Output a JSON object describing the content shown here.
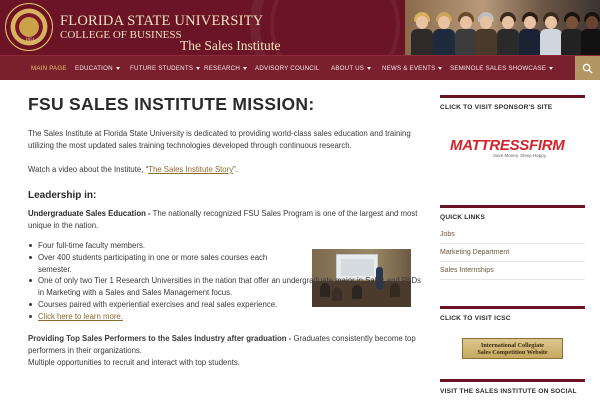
{
  "header": {
    "seal_year": "1851",
    "university": "FLORIDA STATE UNIVERSITY",
    "college": "COLLEGE OF BUSINESS",
    "institute": "The Sales Institute",
    "brand_color": "#6b1425",
    "accent_color": "#b29664"
  },
  "nav": {
    "items": [
      {
        "label": "MAIN PAGE",
        "dropdown": false,
        "active": true
      },
      {
        "label": "EDUCATION",
        "dropdown": true
      },
      {
        "label": "FUTURE STUDENTS",
        "dropdown": true
      },
      {
        "label": "RESEARCH",
        "dropdown": true
      },
      {
        "label": "ADVISORY COUNCIL",
        "dropdown": false
      },
      {
        "label": "ABOUT US",
        "dropdown": true
      },
      {
        "label": "NEWS & EVENTS",
        "dropdown": true
      },
      {
        "label": "SEMINOLE SALES SHOWCASE",
        "dropdown": true
      }
    ],
    "search_icon": "search-icon"
  },
  "main": {
    "title": "FSU SALES INSTITUTE MISSION:",
    "intro": "The Sales Institute at Florida State University is dedicated to  providing world-class sales education and training utilizing the most updated sales training technologies developed through continuous research.",
    "video_prefix": "Watch a video about the Institute, “",
    "video_link": "The Sales Institute Story",
    "video_suffix": "”.",
    "leadership_heading": "Leadership in:",
    "undergrad_heading": "Undergraduate Sales Education -",
    "undergrad_text": " The nationally recognized FSU Sales Program is one of the largest and most unique in the nation.",
    "bullets": [
      "Four full-time faculty members.",
      "Over 400 students participating in one or more sales courses each semester.",
      "One of only two Tier 1 Research Universities in the nation that offer an undergraduate major in Sales and PhDs in Marketing with a Sales and Sales Management focus.",
      "Courses paired with experiential exercises and real sales experience."
    ],
    "learn_more_link": "Click here to learn more.",
    "top_heading": "Providing Top Sales Performers to the Sales Industry after graduation -",
    "top_text": " Graduates consistently become top performers in their organizations.",
    "top_text2": "Multiple opportunities to recruit and interact with top students."
  },
  "sidebar": {
    "sponsor_title": "CLICK TO VISIT SPONSOR'S SITE",
    "sponsor_logo": "MATTRESSFIRM",
    "sponsor_tagline": "Save Money. Sleep Happy.",
    "quick_links_title": "QUICK LINKS",
    "quick_links": [
      "Jobs",
      "Marketing Department",
      "Sales Internships"
    ],
    "icsc_title": "CLICK TO VISIT ICSC",
    "icsc_line1": "International Collegiate",
    "icsc_line2": "Sales Competition Website",
    "social_title": "VISIT THE SALES INSTITUTE ON SOCIAL"
  }
}
